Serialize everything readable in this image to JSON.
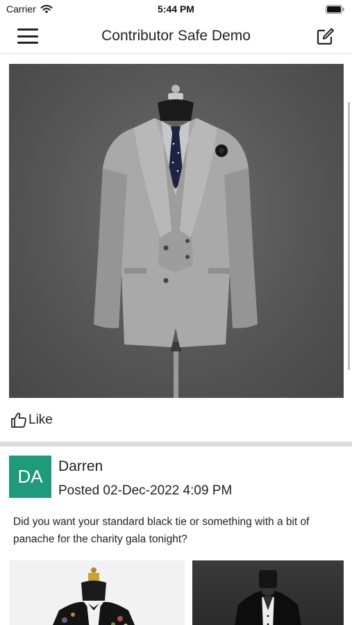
{
  "status_bar": {
    "carrier": "Carrier",
    "time": "5:44 PM",
    "icons": [
      "wifi-icon",
      "battery-icon"
    ]
  },
  "nav": {
    "title": "Contributor Safe Demo",
    "left_icon": "menu-icon",
    "right_icon": "compose-icon"
  },
  "feed": {
    "first_post": {
      "image_subject": "grey-suit-on-mannequin",
      "like_label": "Like",
      "like_icon": "thumbs-up-icon"
    },
    "second_post": {
      "avatar_initials": "DA",
      "avatar_color": "#1f9b7c",
      "author": "Darren",
      "posted": "Posted 02-Dec-2022 4:09 PM",
      "text": "Did you want your standard black tie or something with a bit of panache for the charity gala tonight?",
      "thumbnails": [
        "tuxedo-floral-jacket",
        "black-tuxedo-bowtie"
      ]
    }
  }
}
